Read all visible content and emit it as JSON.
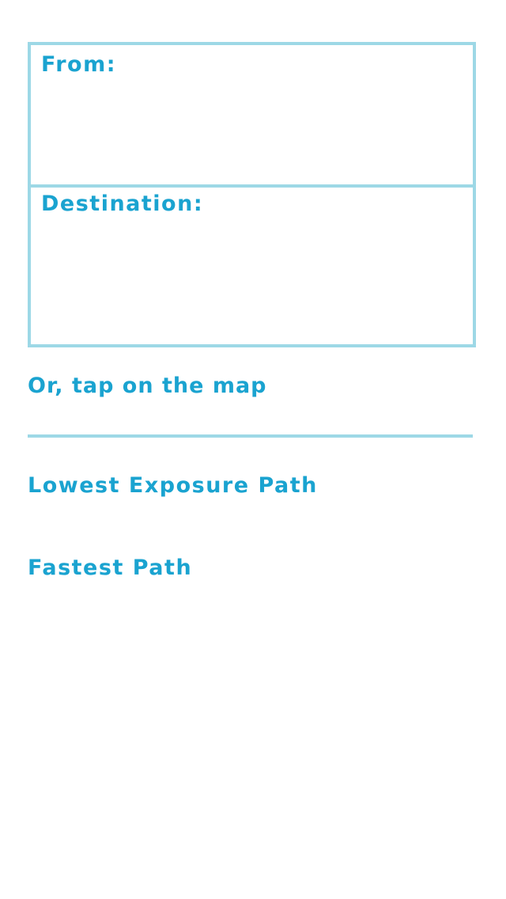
{
  "route": {
    "from_label": "From:",
    "destination_label": "Destination:"
  },
  "hint": "Or, tap on the map",
  "options": {
    "lowest_exposure": "Lowest Exposure Path",
    "fastest": "Fastest Path"
  },
  "colors": {
    "accent_text": "#1aa3d0",
    "border": "#9dd8e6",
    "background": "#ffffff"
  }
}
